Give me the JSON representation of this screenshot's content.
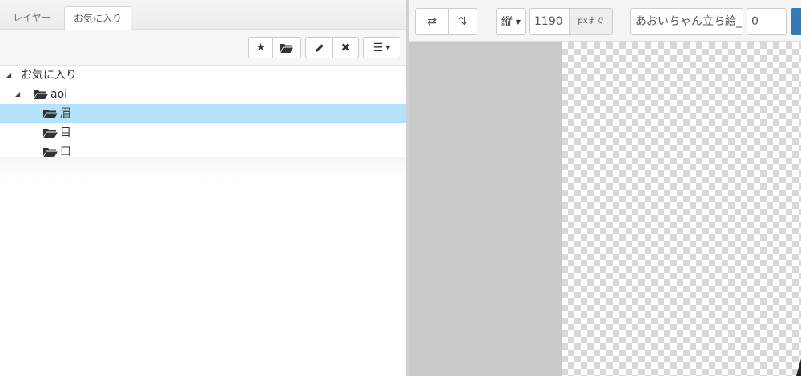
{
  "tabs": [
    {
      "label": "レイヤー",
      "active": false
    },
    {
      "label": "お気に入り",
      "active": true
    }
  ],
  "toolbar": {
    "icons": [
      "star-icon",
      "folder-open-icon",
      "pencil-icon",
      "close-icon",
      "hamburger-menu-icon"
    ]
  },
  "tree": {
    "root": {
      "label": "お気に入り",
      "expanded": true
    },
    "folder": {
      "label": "aoi",
      "expanded": true
    },
    "items": [
      {
        "label": "眉",
        "selected": true
      },
      {
        "label": "目",
        "selected": false
      },
      {
        "label": "口",
        "selected": false
      }
    ]
  },
  "right_toolbar": {
    "direction": "縦",
    "size_value": "1190",
    "size_unit": "pxまで",
    "name_value": "あおいちゃん立ち絵_",
    "index_value": "0"
  },
  "colors": {
    "selection": "#b3e2fa",
    "primary": "#337ab7",
    "panel_bg": "#cbcaca"
  }
}
